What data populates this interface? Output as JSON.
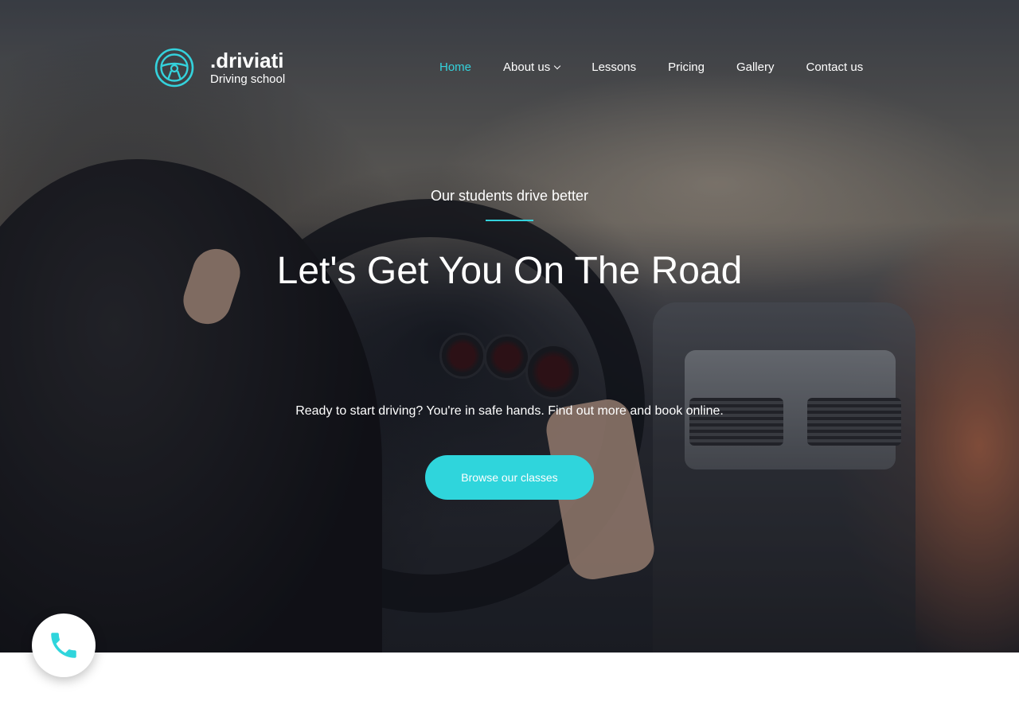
{
  "brand": {
    "name": ".driviati",
    "subtitle": "Driving school",
    "logo_icon": "steering-wheel-icon",
    "accent_color": "#34d2dc"
  },
  "nav": {
    "items": [
      {
        "label": "Home",
        "active": true
      },
      {
        "label": "About us",
        "has_dropdown": true,
        "dropdown_icon": "chevron-down-icon"
      },
      {
        "label": "Lessons"
      },
      {
        "label": "Pricing"
      },
      {
        "label": "Gallery"
      },
      {
        "label": "Contact us"
      }
    ]
  },
  "hero": {
    "tagline": "Our students drive better",
    "headline": "Let's Get You On The Road",
    "subtext": "Ready to start driving? You're in safe hands. Find out more and book online.",
    "cta_label": "Browse our classes",
    "cta_color": "#2fd5dc"
  },
  "floating": {
    "phone_icon": "phone-icon",
    "icon_color": "#2fd5dc"
  }
}
